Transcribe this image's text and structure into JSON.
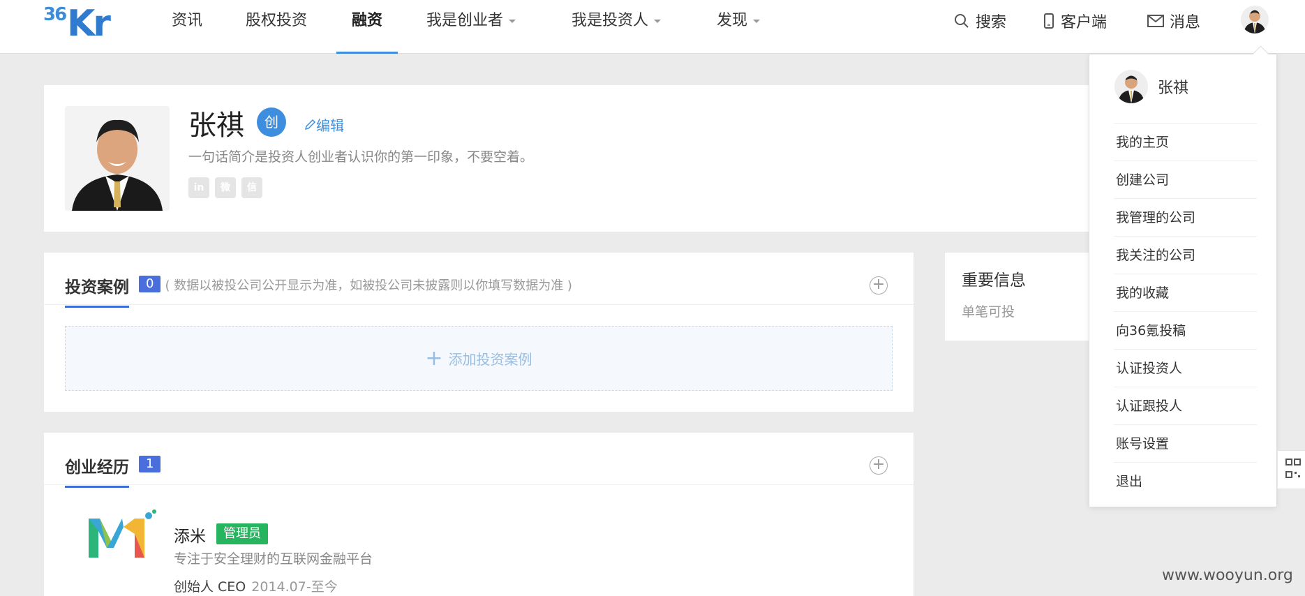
{
  "header": {
    "logo_num": "36",
    "logo_text": "Kr",
    "nav": [
      {
        "label": "资讯",
        "dropdown": false
      },
      {
        "label": "股权投资",
        "dropdown": false
      },
      {
        "label": "融资",
        "dropdown": false,
        "active": true
      },
      {
        "label": "我是创业者",
        "dropdown": true
      },
      {
        "label": "我是投资人",
        "dropdown": true
      },
      {
        "label": "发现",
        "dropdown": true
      }
    ],
    "search_label": "搜索",
    "client_label": "客户端",
    "message_label": "消息"
  },
  "profile": {
    "name": "张祺",
    "badge": "创",
    "edit_label": "编辑",
    "bio": "一句话简介是投资人创业者认识你的第一印象，不要空着。",
    "socials": [
      "in",
      "微",
      "信"
    ]
  },
  "investments": {
    "title": "投资案例",
    "count": "0",
    "note": "( 数据以被投公司公开显示为准，如被投公司未披露则以你填写数据为准 )",
    "add_label": "添加投资案例"
  },
  "experience": {
    "title": "创业经历",
    "count": "1",
    "company": "添米",
    "admin_tag": "管理员",
    "description": "专注于安全理财的互联网金融平台",
    "role": "创始人 CEO",
    "period": "2014.07-至今"
  },
  "important_info": {
    "title": "重要信息",
    "value": "单笔可投"
  },
  "dropdown": {
    "name": "张祺",
    "items": [
      "我的主页",
      "创建公司",
      "我管理的公司",
      "我关注的公司",
      "我的收藏",
      "向36氪投稿",
      "认证投资人",
      "认证跟投人",
      "账号设置",
      "退出"
    ]
  },
  "watermark": "www.wooyun.org",
  "colors": {
    "accent": "#3d8ede",
    "badge": "#4a6fdc",
    "admin": "#26b55e"
  }
}
